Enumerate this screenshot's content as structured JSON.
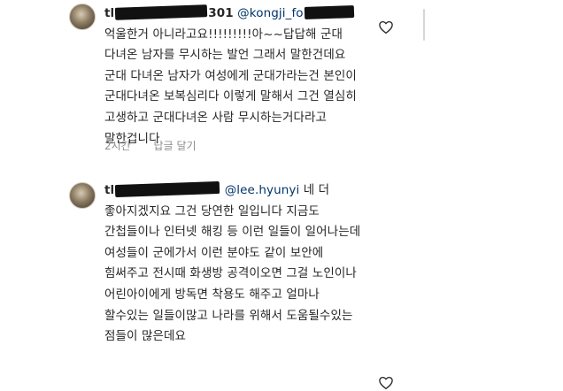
{
  "comments": [
    {
      "username_prefix": "tl",
      "username_suffix": "301",
      "mention": "@kongji_fo",
      "text": " 억울한거 아니라고요!!!!!!!!!아~~답답해 군대 다녀온 남자를 무시하는 발언 그래서 말한건데요 군대 다녀온 남자가 여성에게 군대가라는건 본인이 군대다녀온 보복심리다 이렇게 말해서 그건 열심히 고생하고 군대다녀온 사람 무시하는거다라고 말한겁니다",
      "time": "2시간",
      "reply": "답글 달기",
      "like_icon": "heart-outline-icon"
    },
    {
      "username_prefix": "tl",
      "username_suffix": "",
      "mention": "@lee.hyunyi",
      "text": " 네 더 좋아지겠지요 그건 당연한 일입니다 지금도 간첩들이나 인터넷 해킹 등 이런 일들이 일어나는데 여성들이 군에가서 이런 분야도 같이 보안에 힘써주고 전시때 화생방 공격이오면 그걸 노인이나 어린아이에게 방독면 착용도 해주고 얼마나 할수있는 일들이많고 나라를 위해서 도움될수있는 점들이 많은데요",
      "like_icon": "heart-outline-icon"
    }
  ]
}
